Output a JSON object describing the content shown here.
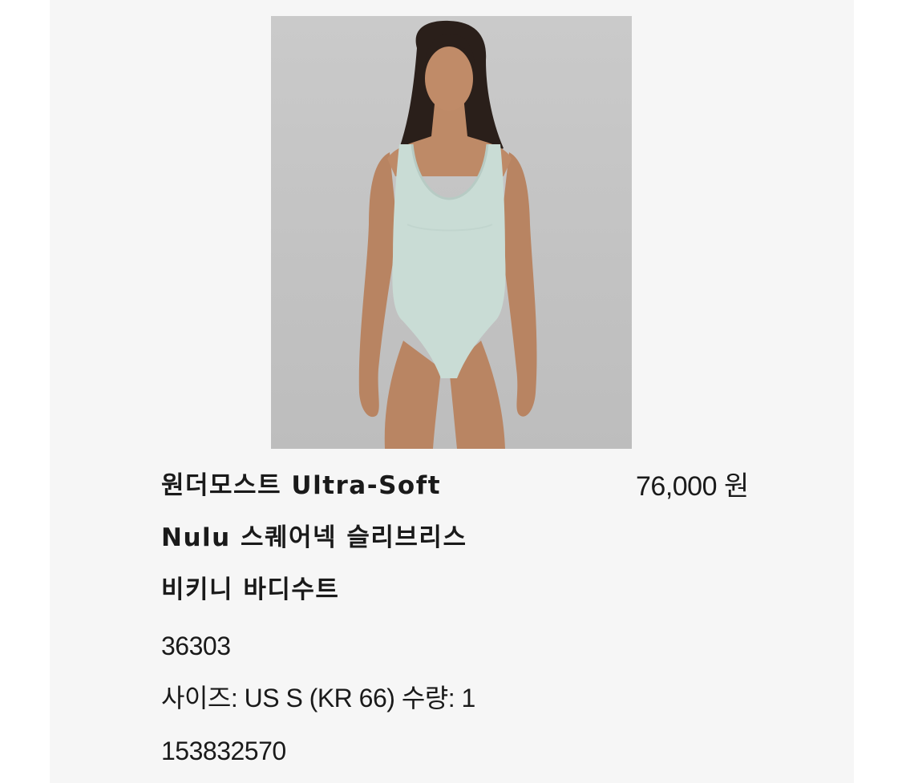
{
  "product": {
    "image_alt": "model wearing light mint square-neck sleeveless one-piece swimsuit",
    "title_lines": [
      "원더모스트 Ultra-Soft",
      "Nulu 스퀘어넥 슬리브리스",
      "비키니 바디수트"
    ],
    "price": "76,000 원",
    "style_number": "36303",
    "size_quantity": "사이즈: US S (KR 66) 수량: 1",
    "item_number": "153832570"
  },
  "colors": {
    "page_background": "#ffffff",
    "panel_background": "#f6f6f6",
    "photo_background": "#c6c6c6",
    "swimsuit": "#c9dcd5",
    "text": "#1a1a1a"
  }
}
